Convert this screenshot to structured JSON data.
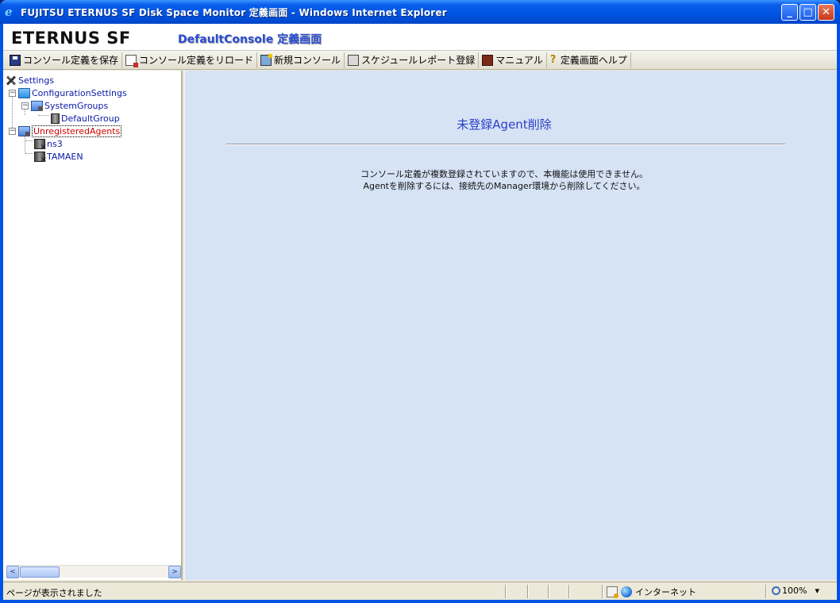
{
  "window": {
    "title": "FUJITSU ETERNUS SF Disk Space Monitor 定義画面 - Windows Internet Explorer",
    "minimize": "_",
    "maximize": "□",
    "close": "✕"
  },
  "banner": {
    "brand": "ETERNUS SF",
    "console_title": "DefaultConsole 定義画面"
  },
  "toolbar": {
    "items": [
      {
        "label": "コンソール定義を保存",
        "icon": "save-icon"
      },
      {
        "label": "コンソール定義をリロード",
        "icon": "reload-icon"
      },
      {
        "label": "新規コンソール",
        "icon": "new-console-icon"
      },
      {
        "label": "スケジュールレポート登録",
        "icon": "report-icon"
      },
      {
        "label": "マニュアル",
        "icon": "manual-icon"
      },
      {
        "label": "定義画面ヘルプ",
        "icon": "help-icon"
      }
    ]
  },
  "tree": {
    "root": "Settings",
    "config": "ConfigurationSettings",
    "system_groups": "SystemGroups",
    "default_group": "DefaultGroup",
    "unregistered": "UnregisteredAgents",
    "agents": [
      "ns3",
      "TAMAEN"
    ],
    "expand_symbol": "−"
  },
  "content": {
    "heading": "未登録Agent削除",
    "message_line1": "コンソール定義が複数登録されていますので、本機能は使用できません。",
    "message_line2": "Agentを削除するには、接続先のManager環境から削除してください。"
  },
  "scrollbar": {
    "left": "<",
    "right": ">"
  },
  "statusbar": {
    "status_text": "ページが表示されました",
    "zone": "インターネット",
    "zoom": "100%",
    "zoom_arrow": "▾"
  }
}
